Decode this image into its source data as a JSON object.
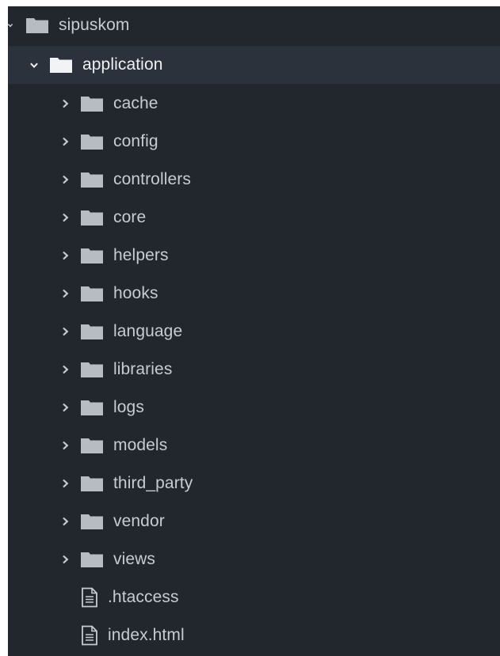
{
  "tree": {
    "root": {
      "label": "sipuskom",
      "expanded": true,
      "children": [
        {
          "label": "application",
          "expanded": true,
          "selected": true,
          "children": [
            {
              "label": "cache",
              "type": "folder"
            },
            {
              "label": "config",
              "type": "folder"
            },
            {
              "label": "controllers",
              "type": "folder"
            },
            {
              "label": "core",
              "type": "folder"
            },
            {
              "label": "helpers",
              "type": "folder"
            },
            {
              "label": "hooks",
              "type": "folder"
            },
            {
              "label": "language",
              "type": "folder"
            },
            {
              "label": "libraries",
              "type": "folder"
            },
            {
              "label": "logs",
              "type": "folder"
            },
            {
              "label": "models",
              "type": "folder"
            },
            {
              "label": "third_party",
              "type": "folder"
            },
            {
              "label": "vendor",
              "type": "folder"
            },
            {
              "label": "views",
              "type": "folder"
            },
            {
              "label": ".htaccess",
              "type": "file"
            },
            {
              "label": "index.html",
              "type": "file"
            }
          ]
        }
      ]
    }
  },
  "colors": {
    "background": "#22272e",
    "selected_row": "#2c323b",
    "text": "#c8ccd1",
    "folder_icon": "#b7bcc3",
    "chevron": "#c8ccd1"
  },
  "icons": {
    "folder": "folder-icon",
    "file": "file-icon",
    "collapsed": "chevron-right-icon",
    "expanded": "chevron-down-icon"
  }
}
